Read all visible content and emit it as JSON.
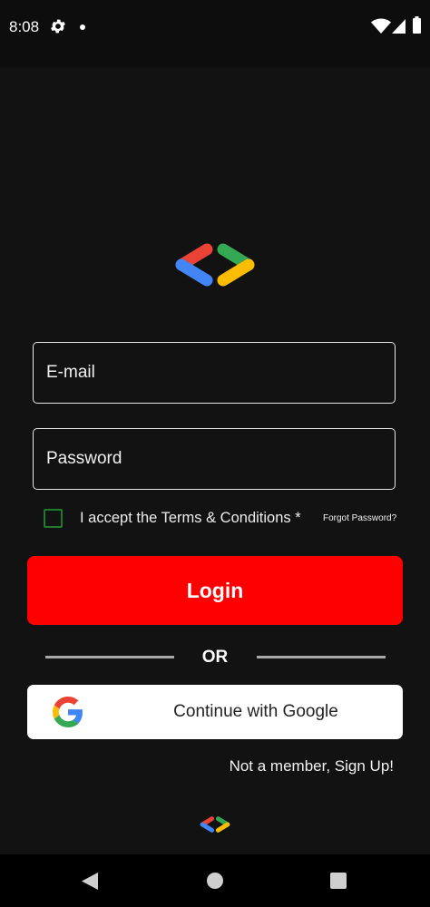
{
  "status_bar": {
    "time": "8:08",
    "icons": [
      "gear-icon",
      "notification-dot-icon",
      "wifi-icon",
      "signal-icon",
      "battery-icon"
    ]
  },
  "logo": {
    "icon": "google-developers-logo-icon",
    "colors": {
      "red": "#EA4335",
      "blue": "#4285F4",
      "green": "#34A853",
      "yellow": "#FBBC04"
    }
  },
  "form": {
    "email_placeholder": "E-mail",
    "password_placeholder": "Password",
    "terms_label": "I accept the Terms & Conditions *",
    "terms_checked": false,
    "forgot_password": "Forgot Password?",
    "login_label": "Login",
    "login_color": "#FF0000",
    "or_label": "OR",
    "google_label": "Continue with Google",
    "signup_label": "Not a member, Sign Up!"
  },
  "nav_bar": {
    "icons": [
      "back-icon",
      "home-icon",
      "recents-icon"
    ]
  }
}
